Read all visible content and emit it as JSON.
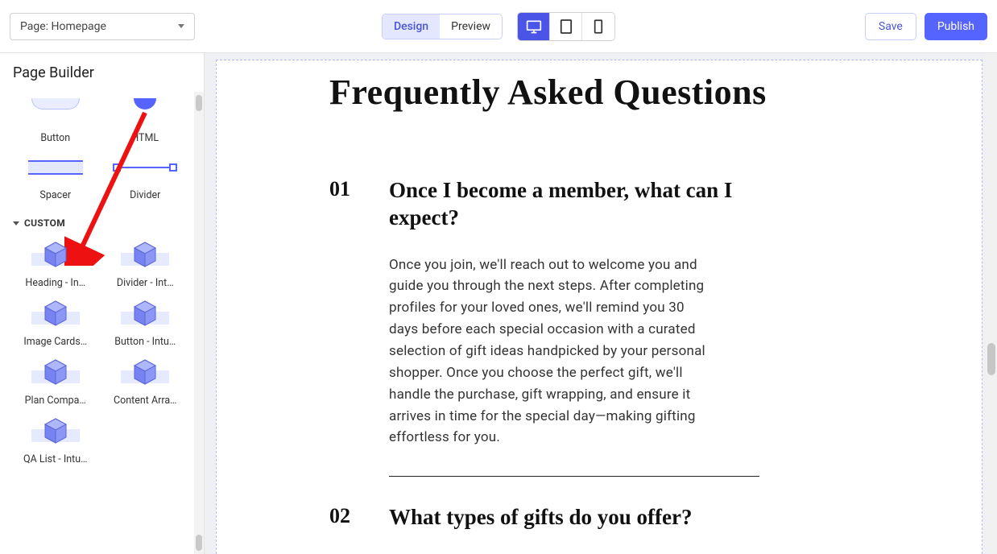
{
  "topbar": {
    "page_select_label": "Page: Homepage",
    "mode": {
      "design": "Design",
      "preview": "Preview"
    },
    "devices": {
      "desktop": "desktop",
      "tablet": "tablet",
      "mobile": "mobile"
    },
    "save_label": "Save",
    "publish_label": "Publish"
  },
  "sidebar": {
    "title": "Page Builder",
    "basic_items": [
      {
        "label": "Button",
        "kind": "button"
      },
      {
        "label": "HTML",
        "kind": "html"
      },
      {
        "label": "Spacer",
        "kind": "spacer"
      },
      {
        "label": "Divider",
        "kind": "divider"
      }
    ],
    "custom_header": "CUSTOM",
    "custom_items": [
      {
        "label": "Heading - In…"
      },
      {
        "label": "Divider - Int…"
      },
      {
        "label": "Image Cards…"
      },
      {
        "label": "Button - Intu…"
      },
      {
        "label": "Plan Compa…"
      },
      {
        "label": "Content Arra…"
      },
      {
        "label": "QA List - Intu…"
      }
    ]
  },
  "canvas": {
    "faq_title": "Frequently Asked Questions",
    "items": [
      {
        "num": "01",
        "question": "Once I become a member, what can I expect?",
        "answer": "Once you join, we'll reach out to welcome you and guide you through the next steps. After completing profiles for your loved ones, we'll remind you 30 days before each special occasion with a curated selection of gift ideas handpicked by your personal shopper. Once you choose the perfect gift, we'll handle the purchase, gift wrapping, and ensure it arrives in time for the special day—making gifting effortless for you."
      },
      {
        "num": "02",
        "question": "What types of gifts do you offer?",
        "answer": ""
      }
    ]
  },
  "annotation": {
    "arrow_color": "#e11"
  }
}
